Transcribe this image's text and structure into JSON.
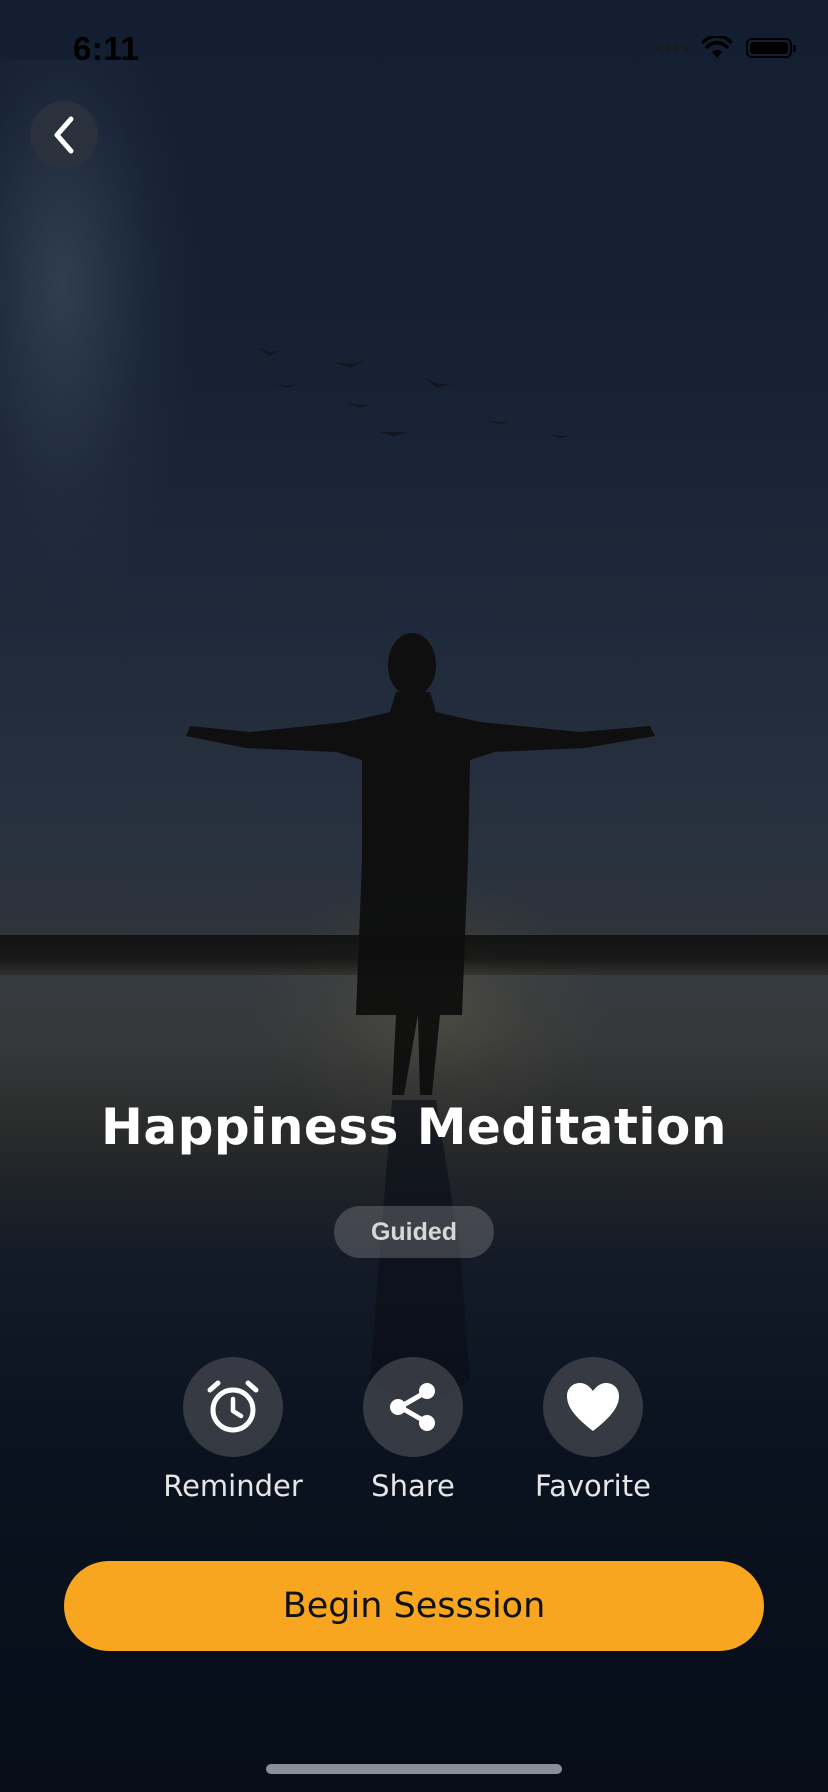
{
  "status_bar": {
    "time": "6:11"
  },
  "title": "Happiness Meditation",
  "tag": "Guided",
  "actions": [
    {
      "label": "Reminder",
      "icon": "alarm-clock-icon"
    },
    {
      "label": "Share",
      "icon": "share-icon"
    },
    {
      "label": "Favorite",
      "icon": "heart-icon"
    }
  ],
  "primary_button": {
    "label": "Begin Sesssion"
  },
  "colors": {
    "accent": "#f8a51f"
  }
}
